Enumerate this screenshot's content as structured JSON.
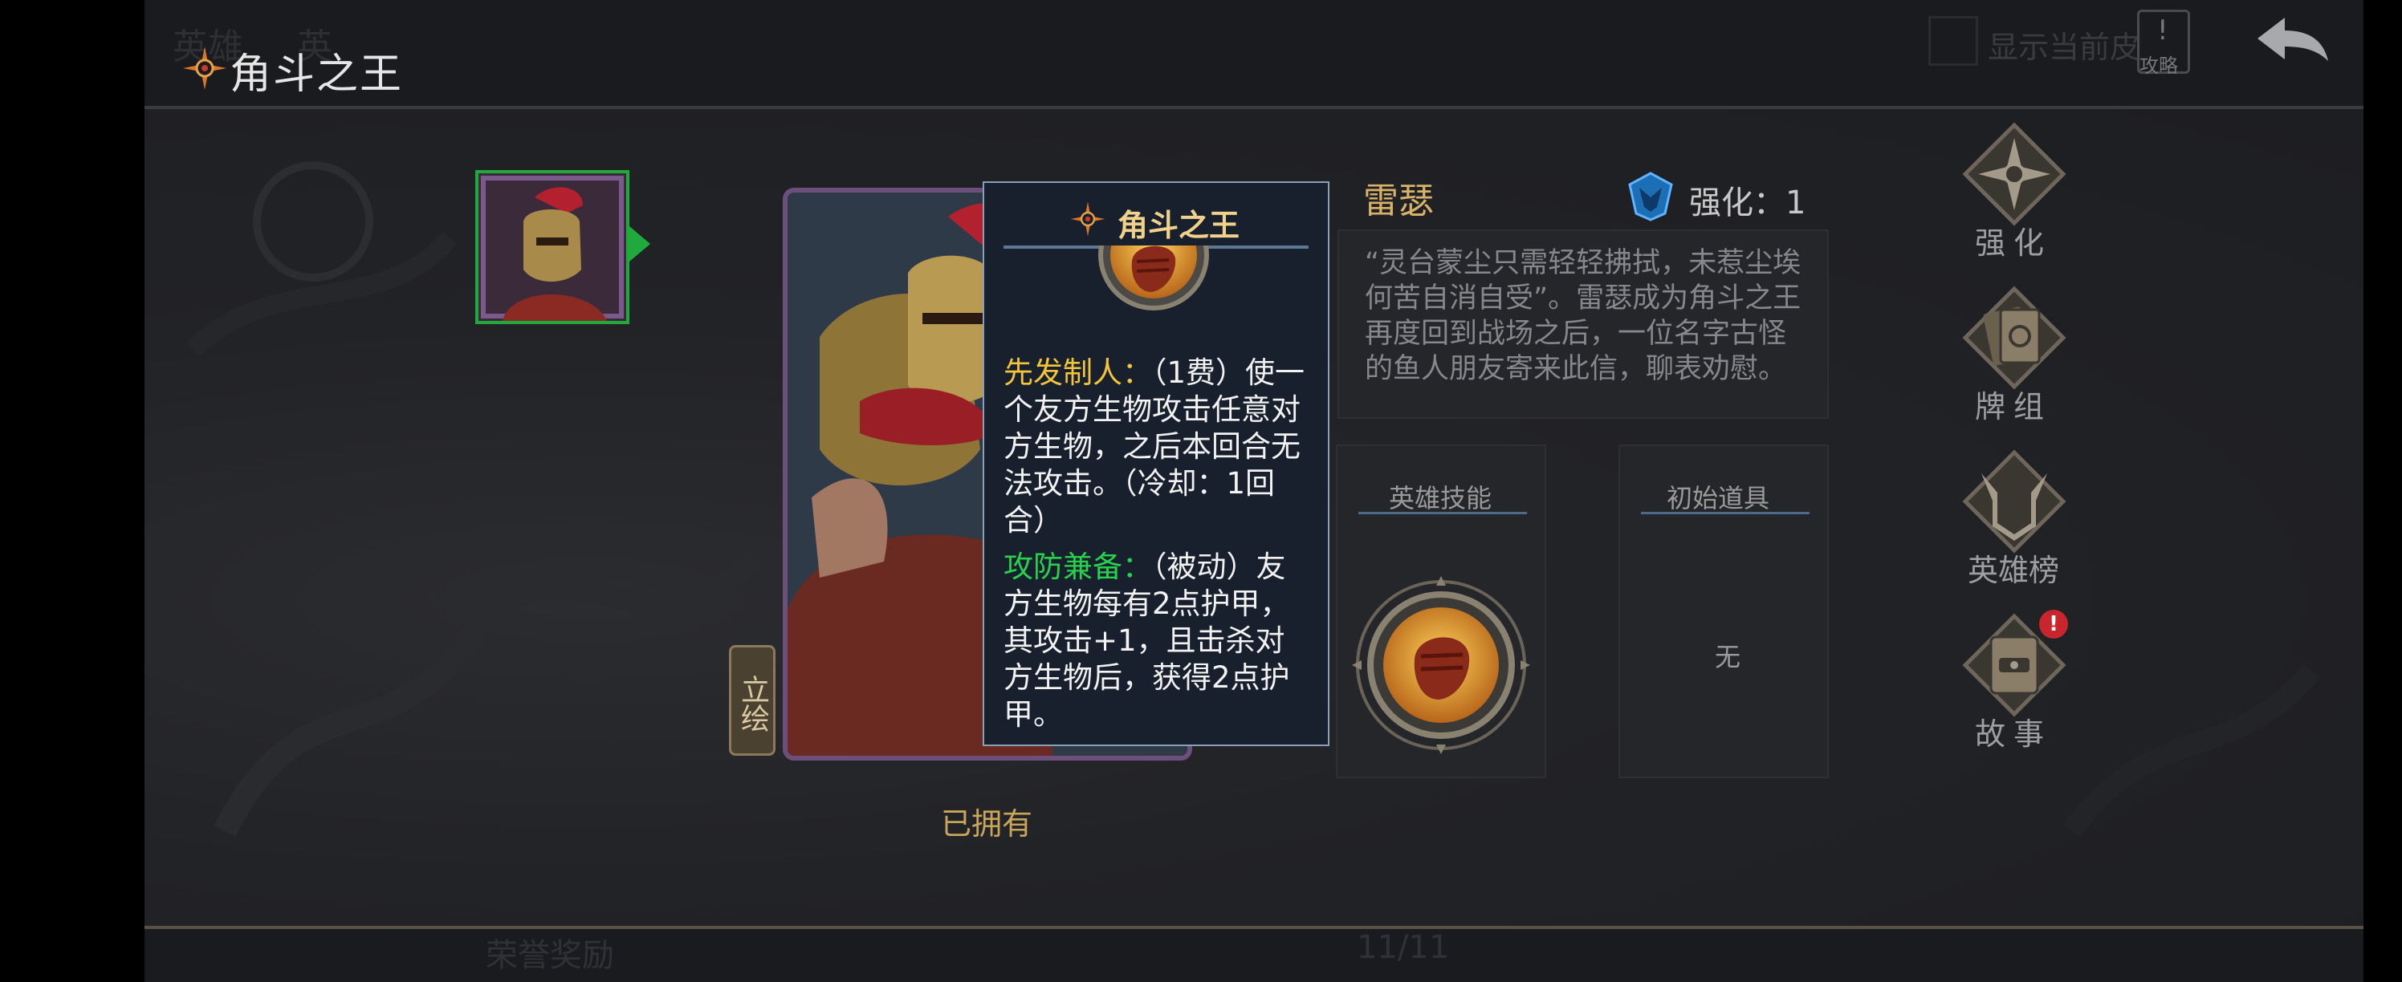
{
  "background": {
    "tab_heroes": "英雄",
    "tab_other": "英",
    "show_current_label": "显示当前皮",
    "guide_label": "攻略",
    "bottom_reward_label": "荣誉奖励",
    "bottom_page_indicator": "11/11"
  },
  "modal": {
    "title": "角斗之王"
  },
  "card": {
    "artwork_button": "立绘",
    "owned_status": "已拥有"
  },
  "tooltip": {
    "title": "角斗之王",
    "skills": [
      {
        "name": "先发制人：",
        "cost": "（1费）",
        "desc": "使一个友方生物攻击任意对方生物，之后本回合无法攻击。（冷却：1回合）"
      },
      {
        "name": "攻防兼备：",
        "cost": "（被动）",
        "desc": "友方生物每有2点护甲，其攻击+1，且击杀对方生物后，获得2点护甲。"
      }
    ]
  },
  "hero": {
    "name": "雷瑟",
    "upgrade_label": "强化：1",
    "flavor": "“灵台蒙尘只需轻轻拂拭，未惹尘埃何苦自消自受”。雷瑟成为角斗之王再度回到战场之后，一位名字古怪的鱼人朋友寄来此信，聊表劝慰。",
    "skill_panel_title": "英雄技能",
    "item_panel_title": "初始道具",
    "item_none": "无"
  },
  "nav": {
    "upgrade": "强化",
    "deck": "牌组",
    "rank": "英雄榜",
    "story": "故事",
    "story_badge": "!"
  },
  "colors": {
    "thumb_border": "#1faa3b",
    "card_border": "#6d4f7b",
    "skill_yellow": "#f3c53b",
    "skill_green": "#27d14d",
    "gold_text": "#d7b36a"
  },
  "icons": {
    "title": "sun-emblem-icon",
    "skill": "fist-icon",
    "upgrade": "blue-crest-icon",
    "back": "back-arrow-icon"
  }
}
